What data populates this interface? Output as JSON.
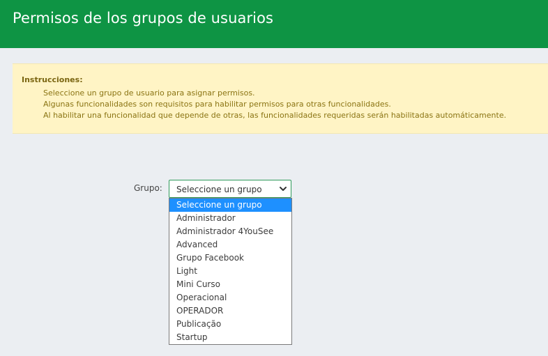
{
  "header": {
    "title": "Permisos de los grupos de usuarios"
  },
  "instructions": {
    "title": "Instrucciones:",
    "lines": [
      "Seleccione un grupo de usuario para asignar permisos.",
      "Algunas funcionalidades son requisitos para habilitar permisos para otras funcionalidades.",
      "Al habilitar una funcionalidad que depende de otras, las funcionalidades requeridas serán habilitadas automáticamente."
    ]
  },
  "form": {
    "group_label": "Grupo:",
    "selected_value": "Seleccione un grupo",
    "chevron_icon": "chevron-down-icon",
    "options": [
      "Seleccione un grupo",
      "Administrador",
      "Administrador 4YouSee",
      "Advanced",
      "Grupo Facebook",
      "Light",
      "Mini Curso",
      "Operacional",
      "OPERADOR",
      "Publicação",
      "Startup"
    ]
  },
  "colors": {
    "header_bg": "#0e9444",
    "instructions_bg": "#fff4c5",
    "selected_option_bg": "#1e90ff"
  }
}
